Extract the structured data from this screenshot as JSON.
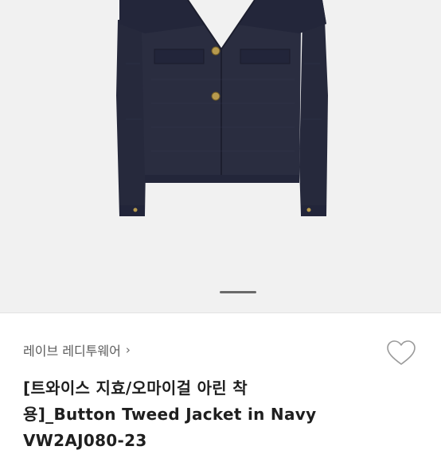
{
  "product": {
    "image": {
      "description_icon": "navy-tweed-jacket-photo",
      "background_color": "#f1f1f1",
      "jacket_color": "#26293c",
      "button_color": "#b79a4e"
    },
    "carousel": {
      "active_index": 1
    },
    "brand": {
      "label": "레이브 레디투웨어",
      "chevron": "›"
    },
    "like": {
      "icon": "heart-outline-icon"
    },
    "title_line1": "[트와이스 지효/오마이걸 아린 착",
    "title_line2": "용]_Button Tweed Jacket in Navy",
    "title_line3": "VW2AJ080-23"
  }
}
